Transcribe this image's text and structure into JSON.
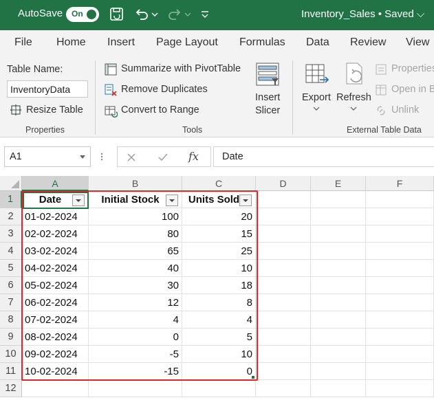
{
  "titlebar": {
    "autosave_label": "AutoSave",
    "toggle_label": "On",
    "filename": "Inventory_Sales • Saved ⌵"
  },
  "tabs": [
    "File",
    "Home",
    "Insert",
    "Page Layout",
    "Formulas",
    "Data",
    "Review",
    "View"
  ],
  "ribbon": {
    "properties": {
      "table_name_label": "Table Name:",
      "table_name_value": "InventoryData",
      "resize_label": "Resize Table",
      "group_label": "Properties"
    },
    "tools": {
      "summarize_label": "Summarize with PivotTable",
      "remove_dup_label": "Remove Duplicates",
      "convert_label": "Convert to Range",
      "insert_slicer_line1": "Insert",
      "insert_slicer_line2": "Slicer",
      "group_label": "Tools"
    },
    "external": {
      "export_label": "Export",
      "refresh_label": "Refresh",
      "properties_label": "Properties",
      "open_in_browser_label": "Open in B",
      "unlink_label": "Unlink",
      "group_label": "External Table Data"
    }
  },
  "formula_bar": {
    "name_box": "A1",
    "fx_label": "fx",
    "content": "Date"
  },
  "grid": {
    "columns": [
      "A",
      "B",
      "C",
      "D",
      "E",
      "F"
    ],
    "rows": [
      "1",
      "2",
      "3",
      "4",
      "5",
      "6",
      "7",
      "8",
      "9",
      "10",
      "11",
      "12"
    ],
    "headers": [
      "Date",
      "Initial Stock",
      "Units Sold"
    ],
    "data": [
      [
        "01-02-2024",
        "100",
        "20"
      ],
      [
        "02-02-2024",
        "80",
        "15"
      ],
      [
        "03-02-2024",
        "65",
        "25"
      ],
      [
        "04-02-2024",
        "40",
        "10"
      ],
      [
        "05-02-2024",
        "30",
        "18"
      ],
      [
        "06-02-2024",
        "12",
        "8"
      ],
      [
        "07-02-2024",
        "4",
        "4"
      ],
      [
        "08-02-2024",
        "0",
        "5"
      ],
      [
        "09-02-2024",
        "-5",
        "10"
      ],
      [
        "10-02-2024",
        "-15",
        "0"
      ]
    ]
  },
  "colors": {
    "excel_green": "#217346",
    "highlight_red": "#e0262a",
    "ribbon_bg": "#f3f3f3"
  }
}
